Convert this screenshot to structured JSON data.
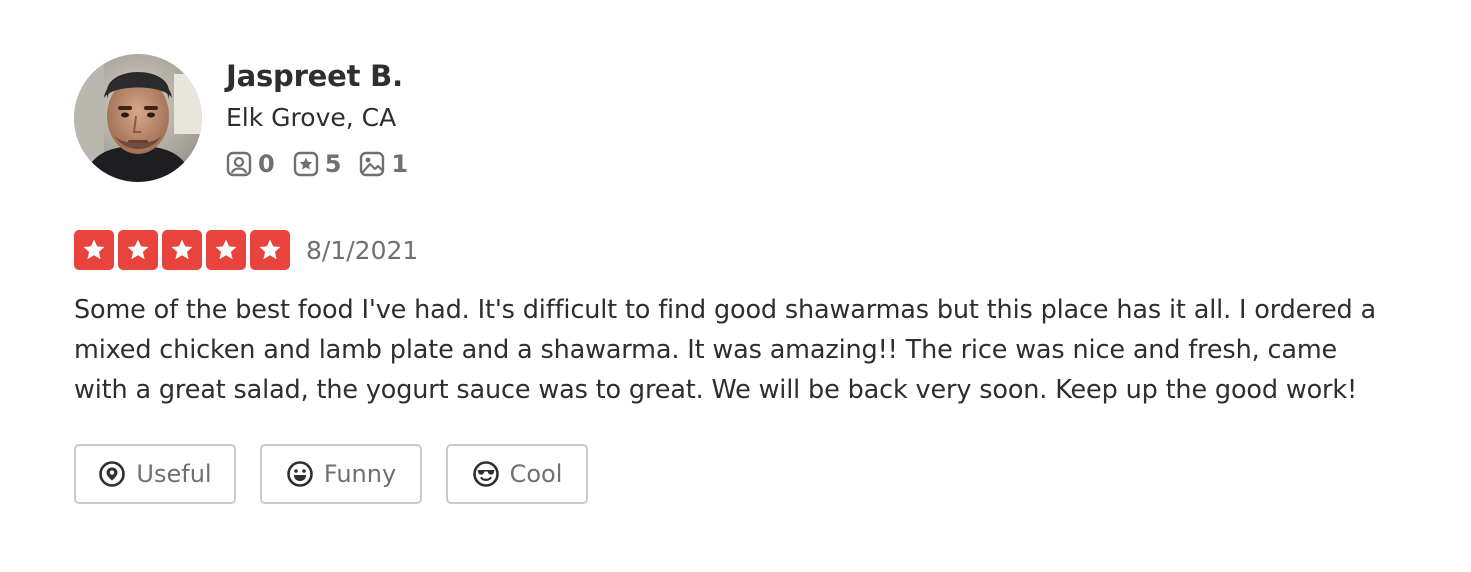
{
  "review": {
    "user": {
      "name": "Jaspreet B.",
      "location": "Elk Grove, CA",
      "stats": [
        {
          "icon": "friends-icon",
          "value": "0"
        },
        {
          "icon": "reviews-star-icon",
          "value": "5"
        },
        {
          "icon": "photos-icon",
          "value": "1"
        }
      ]
    },
    "rating": 5,
    "max_rating": 5,
    "date": "8/1/2021",
    "text": "Some of the best food I've had. It's difficult to find good shawarmas but this place has it all. I ordered a mixed chicken and lamb plate and a shawarma. It was amazing!! The rice was nice and fresh, came with a great salad, the yogurt sauce was to great. We will be back very soon. Keep up the good work!",
    "reactions": [
      {
        "icon": "useful-icon",
        "label": "Useful"
      },
      {
        "icon": "funny-icon",
        "label": "Funny"
      },
      {
        "icon": "cool-icon",
        "label": "Cool"
      }
    ]
  },
  "colors": {
    "star_fill": "#e9433d",
    "star_glyph": "#ffffff",
    "muted_text": "#6e7072",
    "body_text": "#2d2e2f",
    "button_border": "#c8c9ca"
  }
}
